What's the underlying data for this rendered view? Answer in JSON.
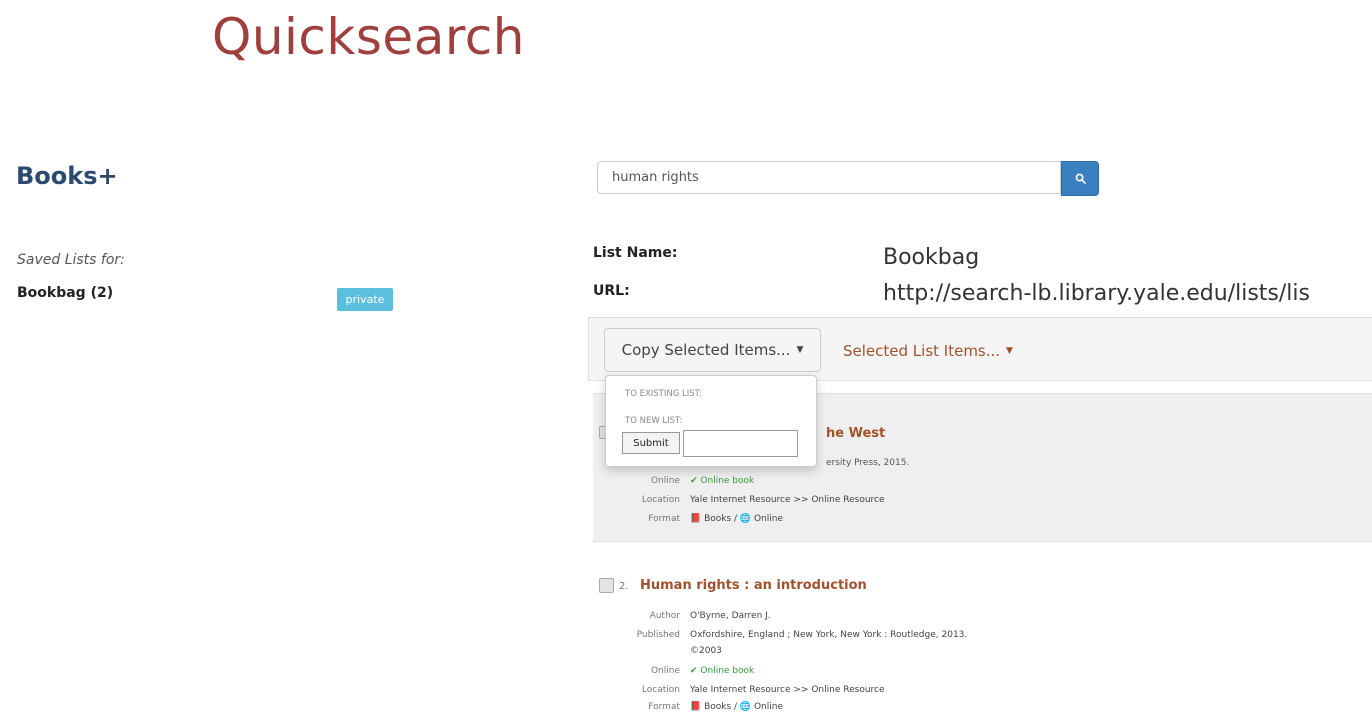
{
  "page": {
    "title": "Quicksearch"
  },
  "app": {
    "title": "Books+"
  },
  "sidebar": {
    "saved_lists_label": "Saved Lists for:",
    "lists": [
      {
        "name": "Bookbag (2)",
        "badge": "private"
      }
    ]
  },
  "search": {
    "query": "human rights",
    "button_icon": "search-icon"
  },
  "list_info": {
    "name_label": "List Name:",
    "name_value": "Bookbag",
    "url_label": "URL:",
    "url_value": "http://search-lb.library.yale.edu/lists/lis"
  },
  "toolbar": {
    "copy_label": "Copy Selected Items...",
    "selected_label": "Selected List Items..."
  },
  "dropdown": {
    "existing_label": "TO EXISTING LIST:",
    "new_label": "TO NEW LIST:",
    "submit_label": "Submit",
    "new_list_value": ""
  },
  "results": [
    {
      "title_fragment": "he West",
      "published_fragment": "ersity Press, 2015.",
      "fields": [
        {
          "label": "Online",
          "value": "✔ Online book",
          "style": "green"
        },
        {
          "label": "Location",
          "value": "Yale Internet Resource >> Online Resource"
        },
        {
          "label": "Format",
          "value": "📕 Books / 🌐 Online"
        }
      ]
    },
    {
      "number": "2.",
      "title": "Human rights : an introduction",
      "fields": [
        {
          "label": "Author",
          "value": "O'Byrne, Darren J."
        },
        {
          "label": "Published",
          "value": "Oxfordshire, England ; New York, New York : Routledge, 2013."
        },
        {
          "label": "",
          "value": "©2003"
        },
        {
          "label": "Online",
          "value": "✔ Online book",
          "style": "green"
        },
        {
          "label": "Location",
          "value": "Yale Internet Resource >> Online Resource"
        },
        {
          "label": "Format",
          "value": "📕 Books / 🌐 Online"
        }
      ]
    }
  ],
  "colors": {
    "brand": "#a0403e",
    "app_title": "#2a4a6f",
    "badge": "#5bc0de",
    "search_button": "#3a80c0",
    "link": "#a0522d"
  }
}
